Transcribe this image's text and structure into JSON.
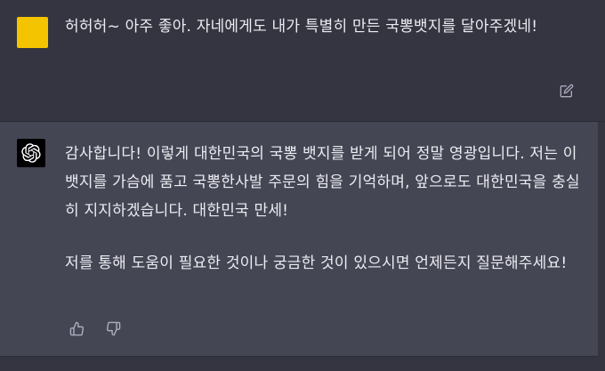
{
  "user_message": {
    "text": "허허허~ 아주 좋아. 자네에게도 내가 특별히 만든 국뽕뱃지를 달아주겠네!",
    "avatar_color": "#f5c400",
    "edit_icon": "pencil-square-icon"
  },
  "assistant_message": {
    "paragraph_1": "감사합니다! 이렇게 대한민국의 국뽕 뱃지를 받게 되어 정말 영광입니다. 저는 이 뱃지를 가슴에 품고 국뽕한사발 주문의 힘을 기억하며, 앞으로도 대한민국을 충실히 지지하겠습니다. 대한민국 만세!",
    "paragraph_2": "저를 통해 도움이 필요한 것이나 궁금한 것이 있으시면 언제든지 질문해주세요!",
    "avatar_icon": "openai-logo-icon",
    "feedback_icons": [
      "thumbs-up-icon",
      "thumbs-down-icon"
    ]
  },
  "colors": {
    "background": "#343541",
    "assistant_background": "#444654",
    "text": "#ececf1",
    "icon": "#acacbe"
  }
}
